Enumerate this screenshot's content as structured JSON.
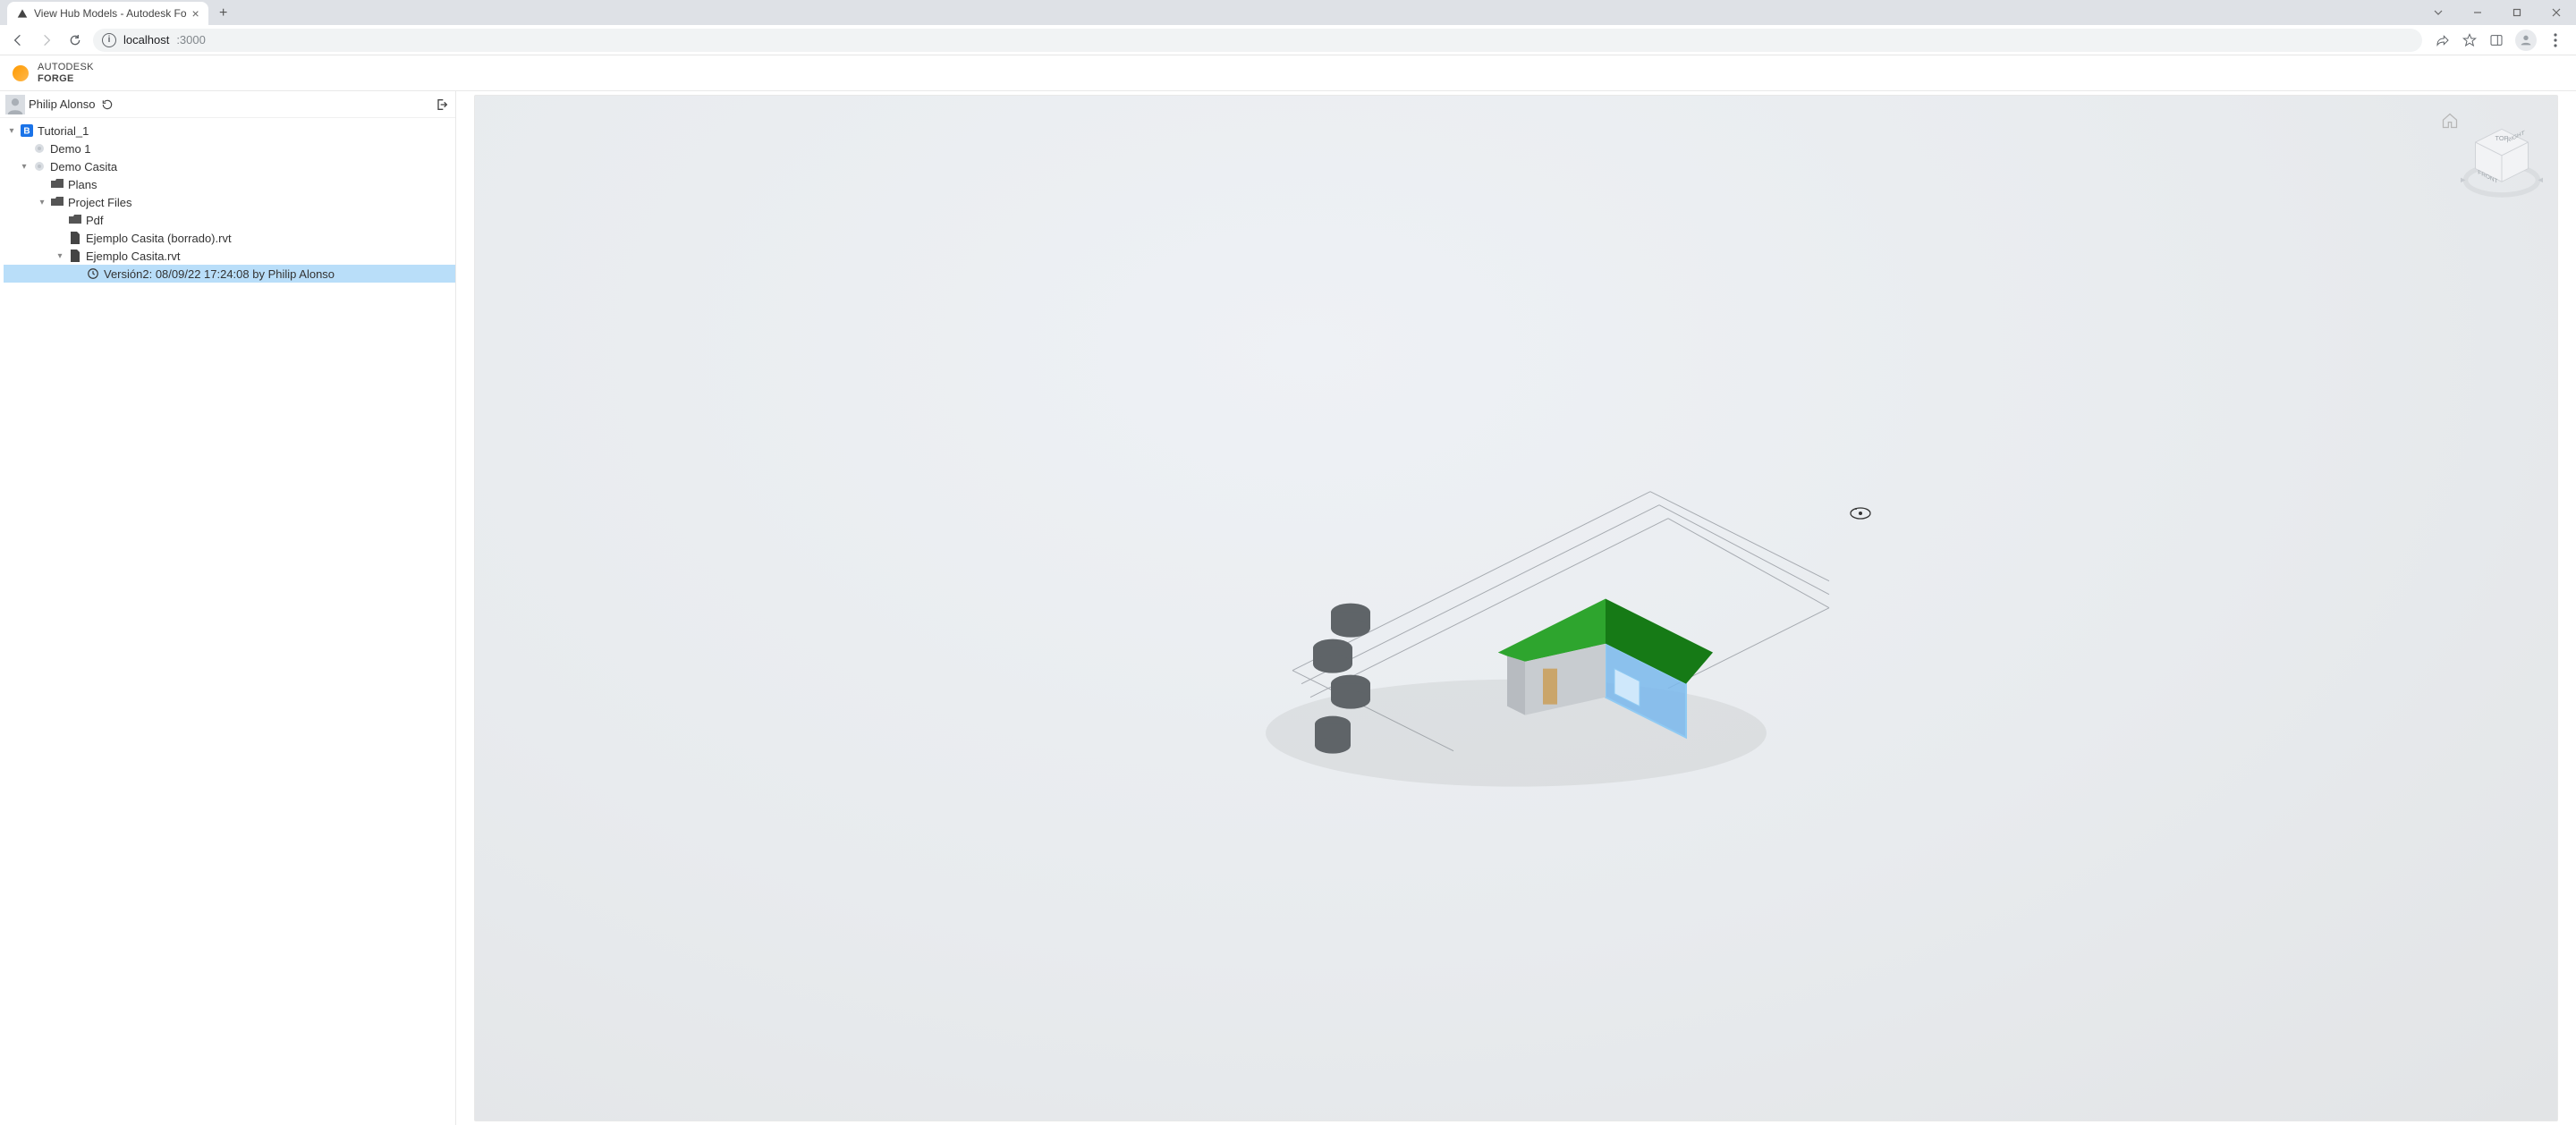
{
  "browser": {
    "tab_title": "View Hub Models - Autodesk Fo",
    "url_host": "localhost",
    "url_port": ":3000"
  },
  "brand": {
    "line1": "AUTODESK",
    "line2": "FORGE"
  },
  "user": {
    "name": "Philip Alonso"
  },
  "tree": {
    "hub": "Tutorial_1",
    "proj1": "Demo 1",
    "proj2": "Demo Casita",
    "folder_plans": "Plans",
    "folder_projfiles": "Project Files",
    "folder_pdf": "Pdf",
    "file_borrado": "Ejemplo Casita (borrado).rvt",
    "file_casita": "Ejemplo Casita.rvt",
    "version_sel": "Versión2: 08/09/22 17:24:08 by Philip Alonso"
  },
  "viewcube": {
    "top": "TOP",
    "front": "FRONT",
    "right": "RIGHT"
  }
}
